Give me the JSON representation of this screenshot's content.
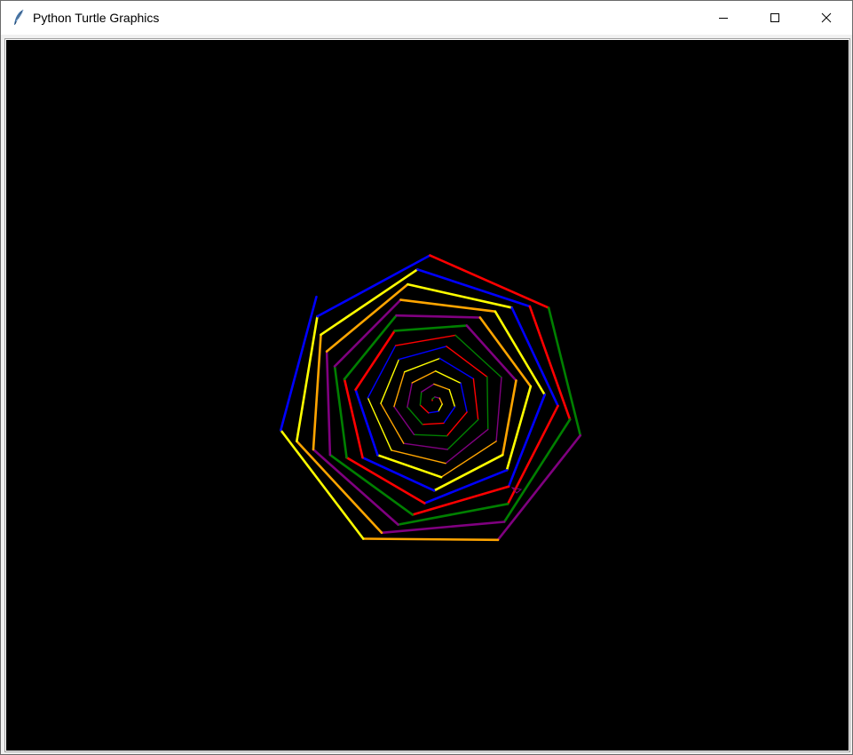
{
  "window": {
    "title": "Python Turtle Graphics",
    "icon": "feather-icon"
  },
  "controls": {
    "minimize_icon": "minimize-icon",
    "maximize_icon": "maximize-icon",
    "close_icon": "close-icon"
  },
  "canvas": {
    "background": "#000000",
    "pen_colors": [
      "#0000ff",
      "#ff0000",
      "#008000",
      "#800080",
      "#ffa500",
      "#ffff00"
    ],
    "pattern": "nested rotating heptagon spiral",
    "turtle_cursor": "classic-arrow"
  }
}
